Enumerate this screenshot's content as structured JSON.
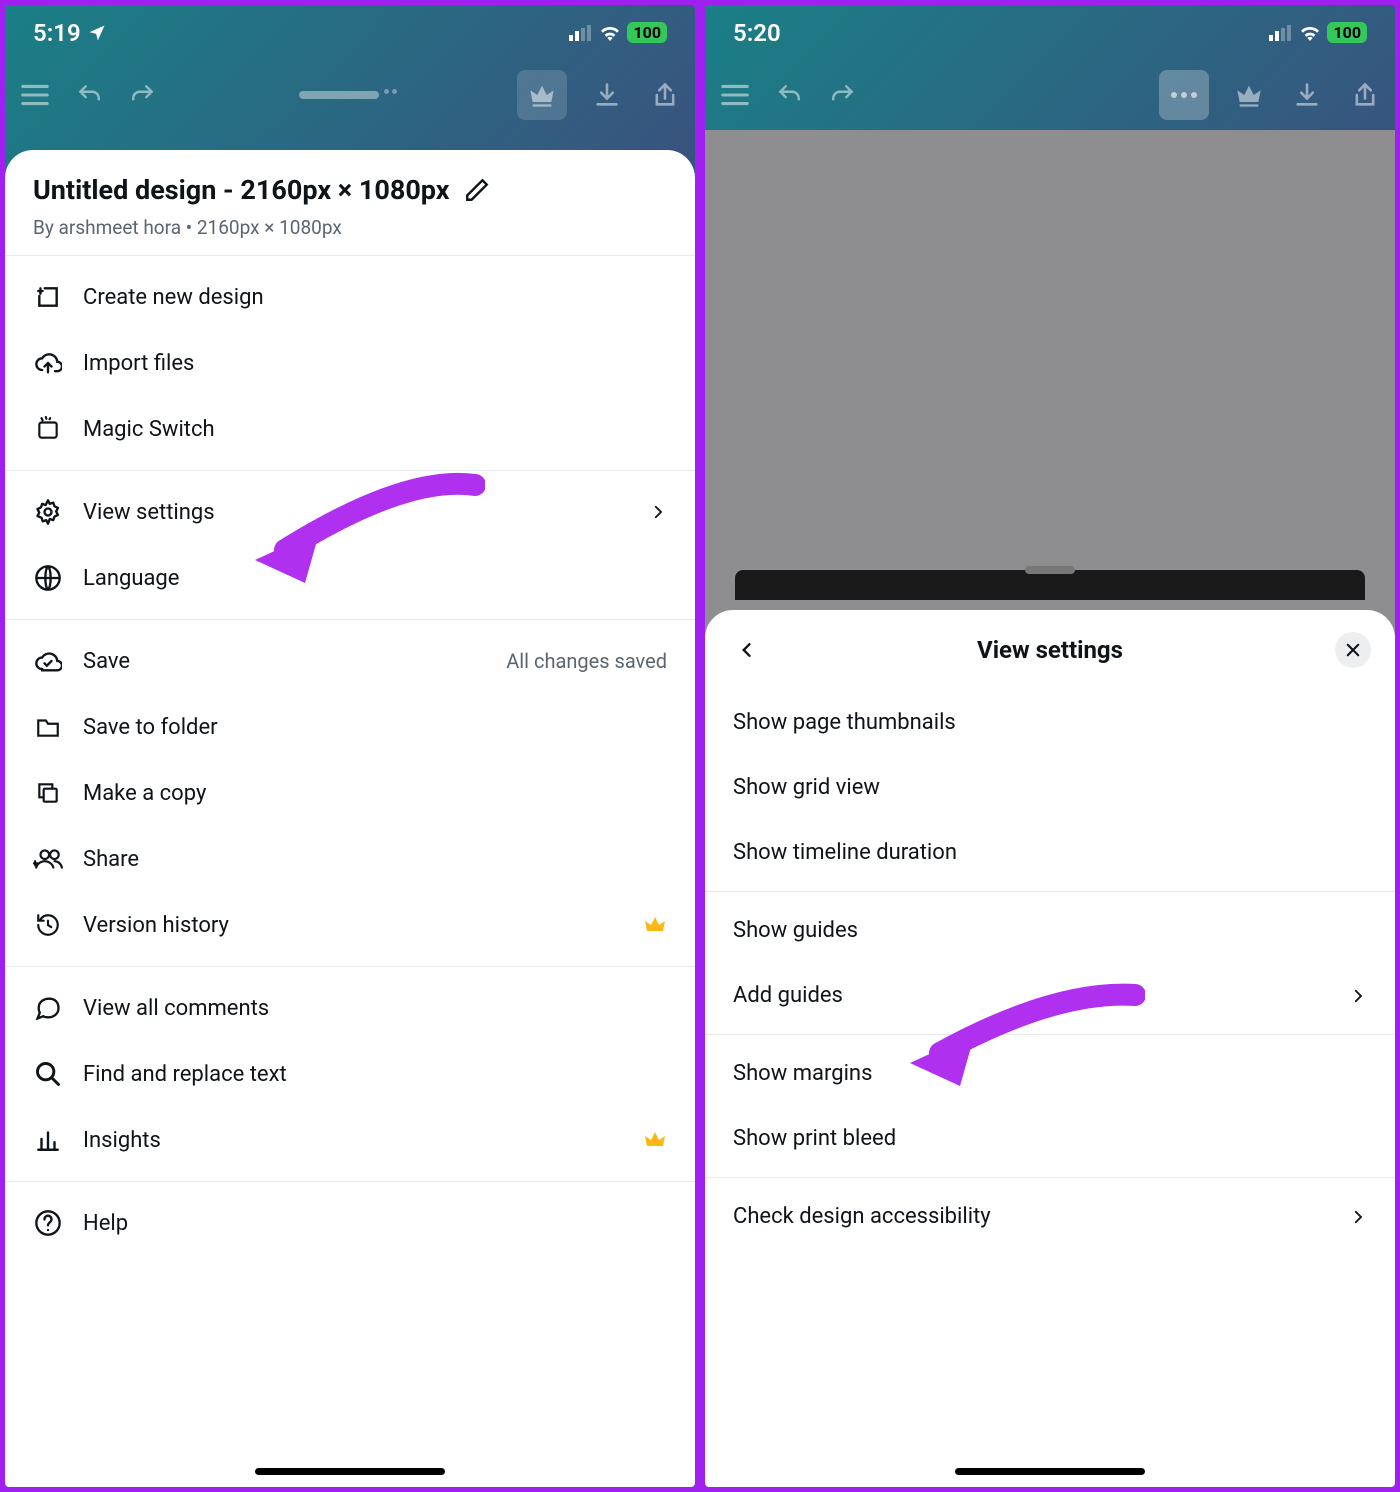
{
  "left": {
    "status": {
      "time": "5:19",
      "battery": "100"
    },
    "sheet": {
      "title": "Untitled design - 2160px × 1080px",
      "byline": "By arshmeet hora • 2160px × 1080px",
      "group1": {
        "create": "Create new design",
        "import": "Import files",
        "magic": "Magic Switch"
      },
      "group2": {
        "view_settings": "View settings",
        "language": "Language"
      },
      "group3": {
        "save": "Save",
        "save_status": "All changes saved",
        "save_folder": "Save to folder",
        "copy": "Make a copy",
        "share": "Share",
        "version": "Version history"
      },
      "group4": {
        "comments": "View all comments",
        "find": "Find and replace text",
        "insights": "Insights"
      },
      "group5": {
        "help": "Help"
      }
    }
  },
  "right": {
    "status": {
      "time": "5:20",
      "battery": "100"
    },
    "sheet": {
      "title": "View settings",
      "items": {
        "thumbnails": "Show page thumbnails",
        "grid": "Show grid view",
        "timeline": "Show timeline duration",
        "guides": "Show guides",
        "add_guides": "Add guides",
        "margins": "Show margins",
        "bleed": "Show print bleed",
        "accessibility": "Check design accessibility"
      }
    }
  }
}
